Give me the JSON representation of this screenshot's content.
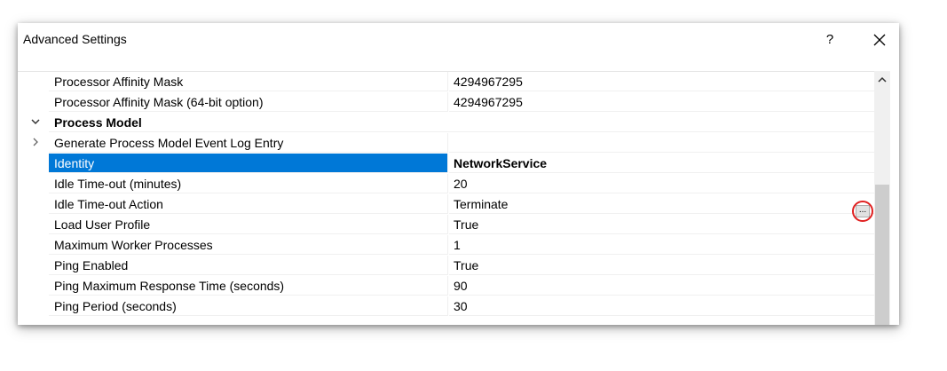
{
  "window": {
    "title": "Advanced Settings",
    "help_label": "?"
  },
  "properties": [
    {
      "name": "Processor Affinity Mask",
      "value": "4294967295"
    },
    {
      "name": "Processor Affinity Mask (64-bit option)",
      "value": "4294967295"
    },
    {
      "name": "Process Model",
      "value": "",
      "category": true,
      "expanded": true
    },
    {
      "name": "Generate Process Model Event Log Entry",
      "value": "",
      "collapsed": true
    },
    {
      "name": "Identity",
      "value": "NetworkService",
      "selected": true
    },
    {
      "name": "Idle Time-out (minutes)",
      "value": "20"
    },
    {
      "name": "Idle Time-out Action",
      "value": "Terminate"
    },
    {
      "name": "Load User Profile",
      "value": "True"
    },
    {
      "name": "Maximum Worker Processes",
      "value": "1"
    },
    {
      "name": "Ping Enabled",
      "value": "True"
    },
    {
      "name": "Ping Maximum Response Time (seconds)",
      "value": "90"
    },
    {
      "name": "Ping Period (seconds)",
      "value": "30"
    }
  ],
  "identity_button_label": "...",
  "colors": {
    "selection": "#0078d7",
    "highlight_circle": "#e02020"
  }
}
